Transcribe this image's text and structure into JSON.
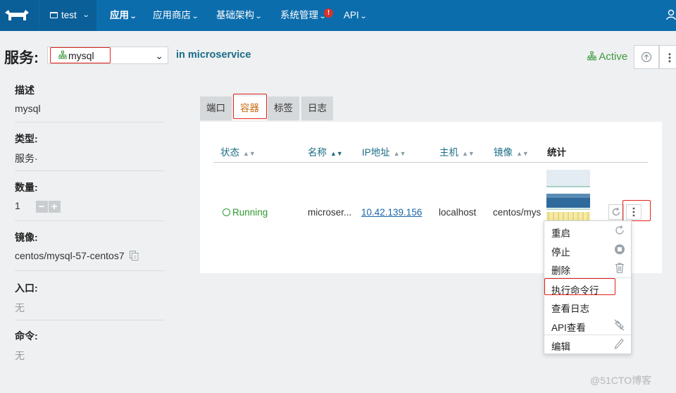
{
  "nav": {
    "environment": "test",
    "items": [
      {
        "label": "应用",
        "active": true
      },
      {
        "label": "应用商店"
      },
      {
        "label": "基础架构"
      },
      {
        "label": "系统管理",
        "alert": "!"
      },
      {
        "label": "API"
      }
    ]
  },
  "header": {
    "label": "服务:",
    "service_value": "mysql",
    "in_text": "in microservice",
    "state": "Active"
  },
  "sidebar": {
    "description_label": "描述",
    "description_value": "mysql",
    "type_label": "类型:",
    "type_value": "服务·",
    "scale_label": "数量:",
    "scale_value": "1",
    "image_label": "镜像:",
    "image_value": "centos/mysql-57-centos7",
    "entry_label": "入口:",
    "entry_value": "无",
    "command_label": "命令:",
    "command_value": "无"
  },
  "tabs": [
    {
      "label": "端口"
    },
    {
      "label": "容器",
      "active": true
    },
    {
      "label": "标签"
    },
    {
      "label": "日志"
    }
  ],
  "table": {
    "headers": {
      "state": "状态",
      "name": "名称",
      "ip": "IP地址",
      "host": "主机",
      "image": "镜像",
      "stats": "统计"
    },
    "row": {
      "state": "Running",
      "name": "microser...",
      "ip": "10.42.139.156",
      "host": "localhost",
      "image": "centos/mysq"
    }
  },
  "menu": {
    "items": [
      {
        "label": "重启",
        "icon": "restart-icon"
      },
      {
        "label": "停止",
        "icon": "stop-icon"
      },
      {
        "label": "删除",
        "icon": "trash-icon"
      },
      {
        "label": "执行命令行",
        "icon": ""
      },
      {
        "label": "查看日志",
        "icon": ""
      },
      {
        "label": "API查看",
        "icon": "api-icon"
      },
      {
        "label": "编辑",
        "icon": "pencil-icon"
      }
    ]
  },
  "watermark": "@51CTO博客",
  "colors": {
    "nav_bg": "#0c6dad",
    "accent_link": "#1a6c86",
    "active_green": "#3c9a3c",
    "highlight_red": "#e2231a",
    "active_tab": "#c86d12"
  }
}
